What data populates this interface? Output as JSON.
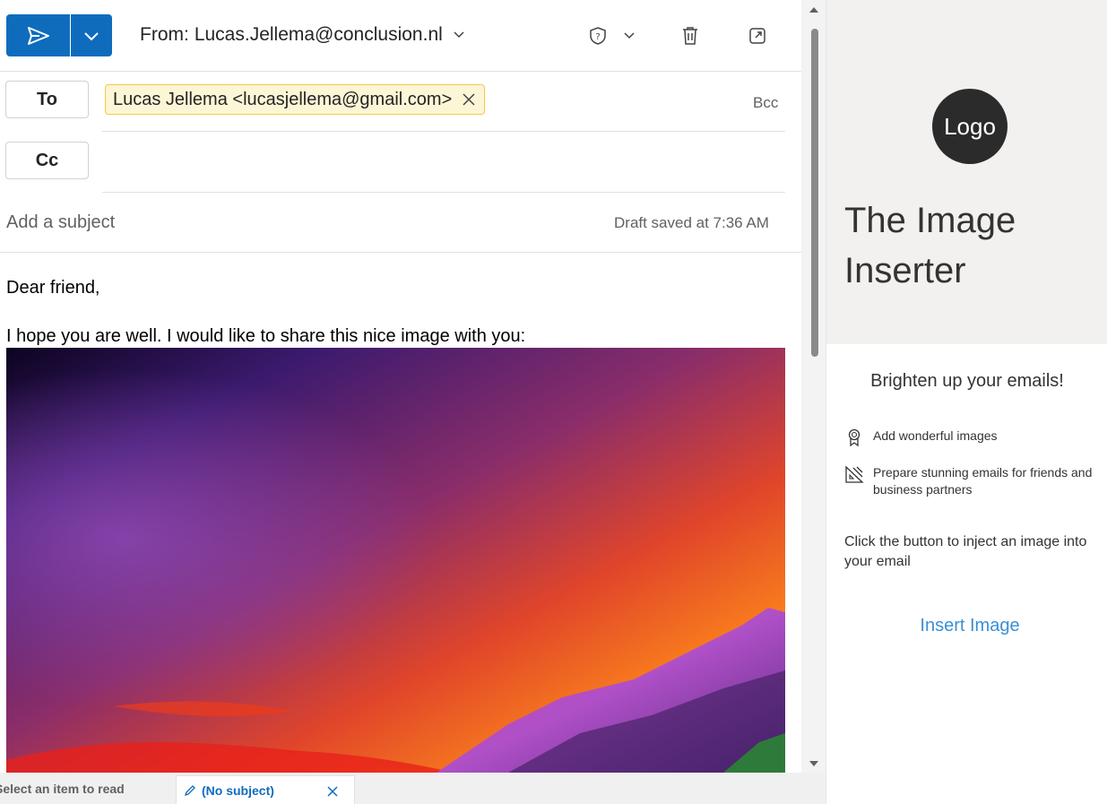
{
  "compose": {
    "from_label": "From:",
    "from_address": "Lucas.Jellema@conclusion.nl",
    "to_label": "To",
    "cc_label": "Cc",
    "bcc_label": "Bcc",
    "recipient_chip": "Lucas Jellema <lucasjellema@gmail.com>",
    "subject_placeholder": "Add a subject",
    "draft_status": "Draft saved at 7:36 AM",
    "body_greeting": "Dear friend,",
    "body_line": "I hope you are well. I would like to share this nice image with you:"
  },
  "bottom_tabs": {
    "read_tab": "Select an item to read",
    "draft_tab": "(No subject)"
  },
  "addin": {
    "logo_text": "Logo",
    "title": "The Image Inserter",
    "tagline": "Brighten up your emails!",
    "features": [
      {
        "icon": "ribbon-icon",
        "text": "Add wonderful images"
      },
      {
        "icon": "design-ideas-icon",
        "text": "Prepare stunning emails for friends and business partners"
      }
    ],
    "instruction": "Click the button to inject an image into your email",
    "insert_button": "Insert Image"
  },
  "colors": {
    "accent": "#0f6cbd",
    "chip_bg": "#fdf6d6",
    "chip_border": "#f5c842",
    "addin_header_bg": "#f2f1ef",
    "link": "#3a8fd6"
  }
}
